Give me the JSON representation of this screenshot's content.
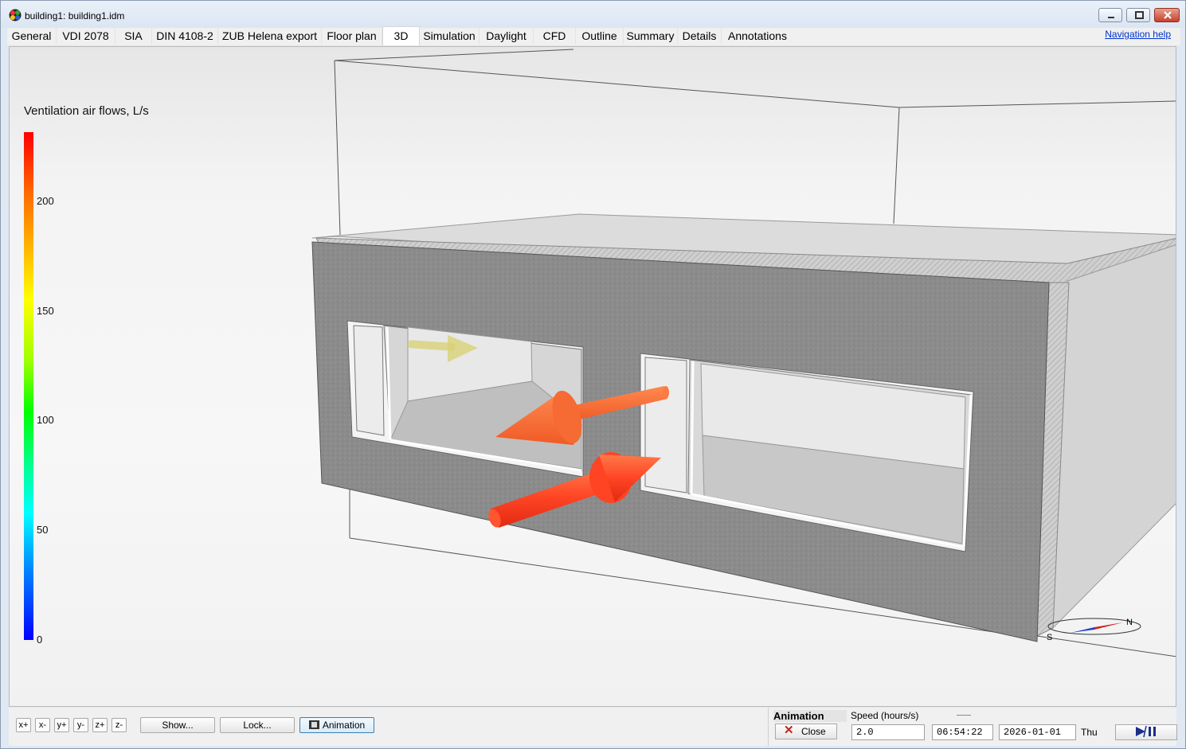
{
  "window": {
    "title": "building1: building1.idm"
  },
  "tabs": [
    {
      "label": "General"
    },
    {
      "label": "VDI 2078"
    },
    {
      "label": "SIA"
    },
    {
      "label": "DIN 4108-2"
    },
    {
      "label": "ZUB Helena export"
    },
    {
      "label": "Floor plan"
    },
    {
      "label": "3D",
      "active": true
    },
    {
      "label": "Simulation"
    },
    {
      "label": "Daylight"
    },
    {
      "label": "CFD"
    },
    {
      "label": "Outline"
    },
    {
      "label": "Summary"
    },
    {
      "label": "Details"
    },
    {
      "label": "Annotations"
    }
  ],
  "nav_help": "Navigation help",
  "legend": {
    "title": "Ventilation air flows, L/s",
    "ticks": [
      "200",
      "150",
      "100",
      "50",
      "0"
    ],
    "colors": {
      "max": "#ff0000",
      "min": "#0000ff"
    }
  },
  "compass": {
    "north": "N",
    "south": "S"
  },
  "view_buttons": [
    "x+",
    "x-",
    "y+",
    "y-",
    "z+",
    "z-"
  ],
  "toolbar": {
    "show_label": "Show...",
    "lock_label": "Lock...",
    "animation_label": "Animation"
  },
  "animation": {
    "title": "Animation",
    "speed_label": "Speed (hours/s)",
    "close_label": "Close",
    "speed_value": "2.0",
    "time_value": "06:54:22",
    "date_value": "2026-01-01",
    "day": "Thu",
    "play_icon": "play-pause-icon"
  },
  "colors": {
    "wall": "#8a8a8a",
    "arrow": "#ff4a2a",
    "arrow_faded": "#d8d070",
    "accent": "#0033cc"
  }
}
